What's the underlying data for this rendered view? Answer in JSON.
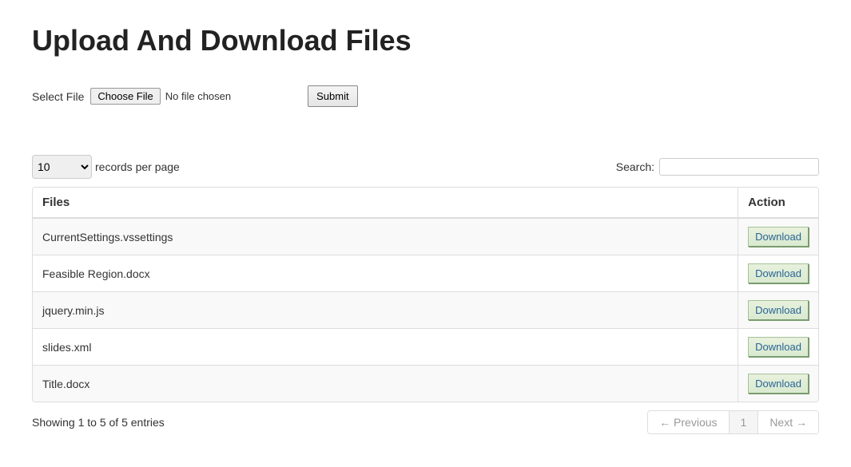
{
  "heading": "Upload And Download Files",
  "upload": {
    "selectLabel": "Select File",
    "chooseLabel": "Choose File",
    "noFileText": "No file chosen",
    "submitLabel": "Submit"
  },
  "lengthMenu": {
    "selected": "10",
    "suffix": "records per page"
  },
  "search": {
    "label": "Search:",
    "value": ""
  },
  "table": {
    "columns": {
      "files": "Files",
      "action": "Action"
    },
    "downloadLabel": "Download",
    "rows": [
      {
        "name": "CurrentSettings.vssettings"
      },
      {
        "name": "Feasible Region.docx"
      },
      {
        "name": "jquery.min.js"
      },
      {
        "name": "slides.xml"
      },
      {
        "name": "Title.docx"
      }
    ]
  },
  "info": "Showing 1 to 5 of 5 entries",
  "pagination": {
    "prev": "← Previous",
    "current": "1",
    "next": "Next →"
  }
}
